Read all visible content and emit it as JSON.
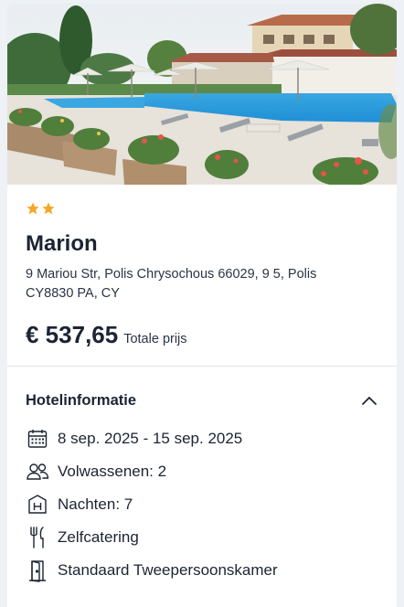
{
  "hotel": {
    "image_alt": "Zwembad met ligstoelen en parasols",
    "stars": 2,
    "star_color": "#f5a623",
    "name": "Marion",
    "address": "9 Mariou Str, Polis Chrysochous 66029, 9 5, Polis CY8830 PA, CY",
    "price": "€ 537,65",
    "price_label": "Totale prijs"
  },
  "info_section": {
    "title": "Hotelinformatie",
    "expanded": true,
    "toggle_icon": "chevron-up-icon",
    "items": [
      {
        "icon": "calendar-icon",
        "text": "8 sep. 2025 - 15 sep. 2025"
      },
      {
        "icon": "users-icon",
        "text": "Volwassenen: 2"
      },
      {
        "icon": "hotel-h-icon",
        "text": "Nachten: 7"
      },
      {
        "icon": "cutlery-icon",
        "text": "Zelfcatering"
      },
      {
        "icon": "door-icon",
        "text": "Standaard Tweepersoonskamer"
      }
    ]
  }
}
